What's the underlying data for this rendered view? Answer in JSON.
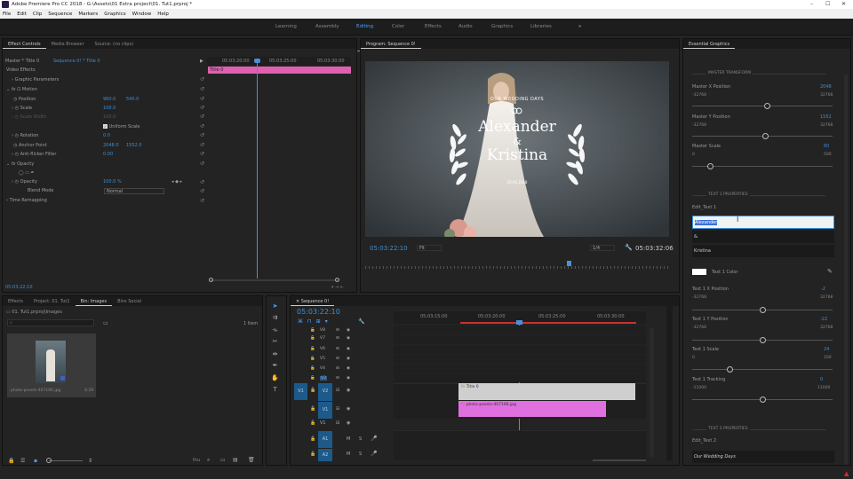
{
  "app": {
    "title": "Adobe Premiere Pro CC 2018 - G:\\Assets\\01 Extra project\\01. Tut1.prproj *"
  },
  "menu": [
    "File",
    "Edit",
    "Clip",
    "Sequence",
    "Markers",
    "Graphics",
    "Window",
    "Help"
  ],
  "workspaces": [
    "Learning",
    "Assembly",
    "Editing",
    "Color",
    "Effects",
    "Audio",
    "Graphics",
    "Libraries"
  ],
  "workspace_active": "Editing",
  "workspace_more": "»",
  "effect_controls": {
    "tabs": [
      "Effect Controls",
      "Media Browser",
      "Source: (no clips)"
    ],
    "master": "Master * Title 0",
    "sequence": "Sequence 0! * Title 0",
    "ruler_times": [
      "05:03:20:00",
      "05:03:25:00",
      "05:03:30:00"
    ],
    "clip_label": "Title 0",
    "section_video": "Video Effects",
    "graphic_params": "Graphic Parameters",
    "motion": "Motion",
    "position_label": "Position",
    "position_x": "960.0",
    "position_y": "540.0",
    "scale_label": "Scale",
    "scale_val": "100.0",
    "scale_width_label": "Scale Width",
    "scale_width_val": "100.0",
    "uniform_scale": "Uniform Scale",
    "rotation_label": "Rotation",
    "rotation_val": "0.0",
    "anchor_label": "Anchor Point",
    "anchor_x": "2048.0",
    "anchor_y": "1552.0",
    "flicker_label": "Anti-flicker Filter",
    "flicker_val": "0.00",
    "opacity_section": "Opacity",
    "opacity_label": "Opacity",
    "opacity_val": "100.0 %",
    "blend_label": "Blend Mode",
    "blend_val": "Normal",
    "time_remap": "Time Remapping",
    "timecode": "05:03:22:10"
  },
  "program": {
    "title": "Program: Sequence 0!",
    "timecode": "05:03:22:10",
    "fit": "Fit",
    "quality": "1/4",
    "duration": "05:03:32:06",
    "overlay_top": "OUR WEDDING DAYS",
    "overlay_name1": "Alexander",
    "overlay_amp": "&",
    "overlay_name2": "Kristina",
    "overlay_date": "20.06.2018"
  },
  "essential_graphics": {
    "title": "Essential Graphics",
    "master_section": "MASTER TRANSFORM",
    "controls": [
      {
        "label": "Master X Position",
        "value": "2048",
        "min": "-32768",
        "max": "32768",
        "pos": 0.53
      },
      {
        "label": "Master Y Position",
        "value": "1552",
        "min": "-32768",
        "max": "32768",
        "pos": 0.52
      },
      {
        "label": "Master Scale",
        "value": "60",
        "min": "0",
        "max": "500",
        "pos": 0.12
      }
    ],
    "text1_section": "TEXT 1 PROPERTIES",
    "edit_text1": "Edit_Text 1",
    "text_fields": [
      "Alexander",
      "&",
      "Kristina"
    ],
    "text1_color": "Text 1 Color",
    "controls2": [
      {
        "label": "Text 1 X Position",
        "value": "-2",
        "min": "-32768",
        "max": "32768",
        "pos": 0.5
      },
      {
        "label": "Text 1 Y Position",
        "value": "-22",
        "min": "-32768",
        "max": "32768",
        "pos": 0.5
      },
      {
        "label": "Text 1 Scale",
        "value": "24",
        "min": "0",
        "max": "100",
        "pos": 0.24
      },
      {
        "label": "Text 1 Tracking",
        "value": "0",
        "min": "-11000",
        "max": "11000",
        "pos": 0.5
      }
    ],
    "text2_section": "TEXT 2 PROPERTIES",
    "edit_text2": "Edit_Text 2",
    "text2_field": "Our Wedding Days"
  },
  "project": {
    "tabs": [
      "Effects",
      "Project: 01. Tut1",
      "Bin: Images",
      "Bins Social"
    ],
    "path": "01. Tut1.prproj\\Images",
    "items_count": "1 Item",
    "thumb_name": "photo-pexels-407166.jpg",
    "thumb_dur": "4:29",
    "zoom_label": "thu"
  },
  "timeline": {
    "title": "Sequence 0!",
    "timecode": "05:03:22:10",
    "ruler": [
      "05:03:15:00",
      "05:03:20:00",
      "05:03:25:00",
      "05:03:30:00"
    ],
    "video_tracks": [
      "V8",
      "V7",
      "V6",
      "V5",
      "V4",
      "V3",
      "V2",
      "V1"
    ],
    "audio_tracks": [
      "A1",
      "A2"
    ],
    "src_v": "V1",
    "src_a": "A1",
    "clip_title": "Title 0",
    "clip_photo": "photo-pexels-407166.jpg"
  },
  "colors": {
    "accent": "#4aa0ff",
    "title_clip": "#cfcfcf",
    "photo_clip": "#e070e0",
    "ec_clip": "#e060b0"
  }
}
